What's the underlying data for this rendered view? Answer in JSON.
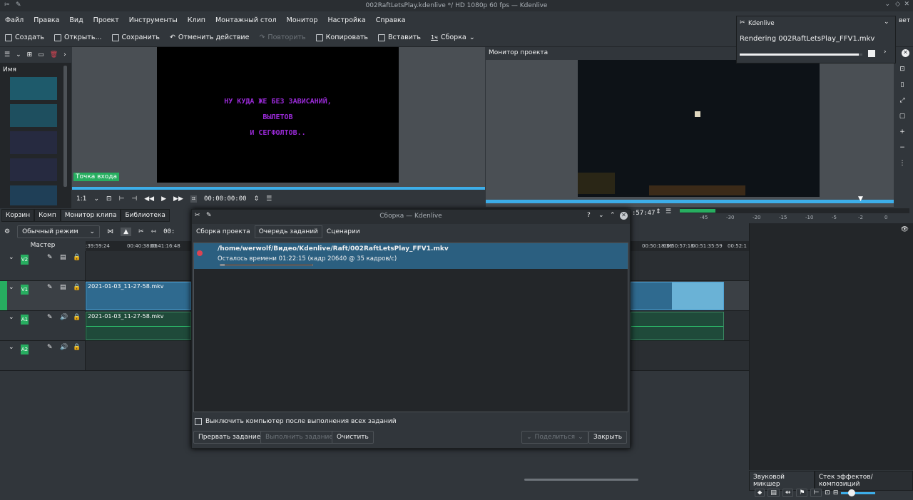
{
  "window_title": "002RaftLetsPlay.kdenlive */ HD 1080p 60 fps — Kdenlive",
  "menu": [
    "Файл",
    "Правка",
    "Вид",
    "Проект",
    "Инструменты",
    "Клип",
    "Монтажный стол",
    "Монитор",
    "Настройка",
    "Справка"
  ],
  "toolbar": {
    "create": "Создать",
    "open": "Открыть...",
    "save": "Сохранить",
    "undo": "Отменить действие",
    "redo": "Повторить",
    "copy": "Копировать",
    "paste": "Вставить",
    "render_icon": "1ч",
    "render": "Сборка"
  },
  "bin": {
    "header": "Имя"
  },
  "clip_monitor": {
    "overlay_lines": [
      "НУ КУДА ЖЕ БЕЗ ЗАВИСАНИЙ,",
      "ВЫЛЕТОВ",
      "И СЕГФОЛТОВ.."
    ],
    "in_point": "Точка входа",
    "zoom": "1:1",
    "timecode": "00:00:00:00"
  },
  "project_monitor": {
    "title": "Монитор проекта",
    "timecode": ":57:47",
    "meter_ticks": [
      "-45",
      "-30",
      "-20",
      "-15",
      "-10",
      "-5",
      "-2",
      "0"
    ]
  },
  "dock_tabs": [
    "Корзин",
    "Комп",
    "Монитор клипа",
    "Библиотека"
  ],
  "timeline": {
    "mode": "Обычный режим",
    "master": "Мастер",
    "timecode_left": "00:",
    "ruler": [
      ":39:59:24",
      "00:40:38:06",
      "00:41:16:48",
      "00:50:18:36",
      "00:50:57:18",
      "00:51:35:59",
      "00:52:1"
    ],
    "tracks": [
      "V2",
      "V1",
      "A1",
      "A2"
    ],
    "clip_name": "2021-01-03_11-27-58.mkv"
  },
  "dialog": {
    "title": "Сборка — Kdenlive",
    "tabs": [
      "Сборка проекта",
      "Очередь заданий",
      "Сценарии"
    ],
    "job_path": "/home/werwolf/Видео/Kdenlive/Raft/002RaftLetsPlay_FFV1.mkv",
    "job_status": "Осталось времени 01:22:15 (кадр 20640 @ 35 кадров/с)",
    "job_progress": 0.05,
    "shutdown": "Выключить компьютер после выполнения всех заданий",
    "abort": "Прервать задание",
    "start": "Выполнить задание",
    "clear": "Очистить",
    "share": "Поделиться",
    "close": "Закрыть"
  },
  "notification": {
    "app": "Kdenlive",
    "text": "Rendering 002RaftLetsPlay_FFV1.mkv",
    "progress": 0.97,
    "side_label": "вет"
  },
  "bottom_tabs": [
    "Звуковой микшер",
    "Стек эффектов/композиций"
  ],
  "colors": {
    "accent": "#3daee9",
    "green": "#27ae60",
    "record": "#da4453"
  }
}
